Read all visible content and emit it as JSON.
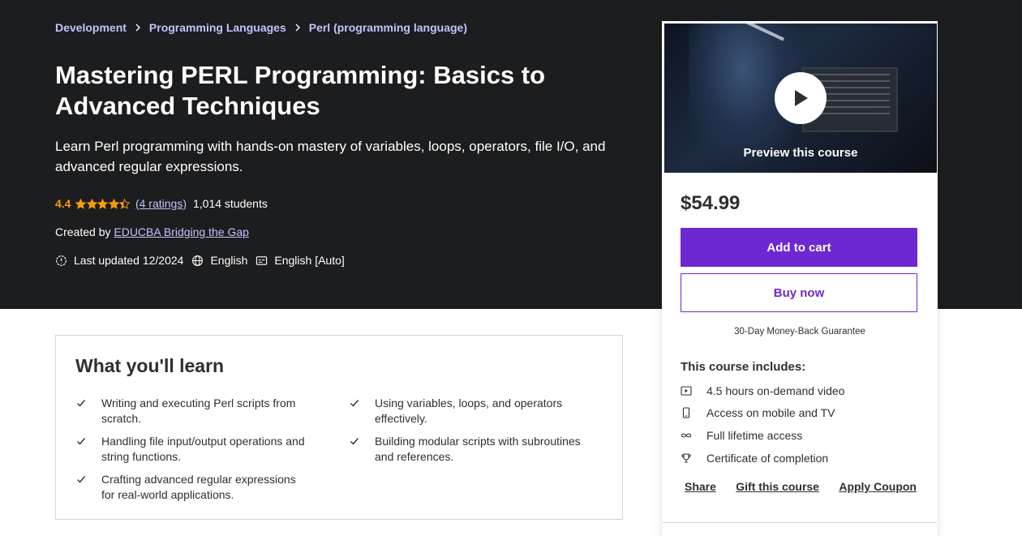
{
  "breadcrumb": {
    "items": [
      "Development",
      "Programming Languages",
      "Perl (programming language)"
    ]
  },
  "course": {
    "title": "Mastering PERL Programming: Basics to Advanced Techniques",
    "subtitle": "Learn Perl programming with hands-on mastery of variables, loops, operators, file I/O, and advanced regular expressions.",
    "rating": "4.4",
    "rating_value": 4.4,
    "ratings_link": "(4 ratings)",
    "students": "1,014 students",
    "created_by_label": "Created by",
    "instructor": "EDUCBA Bridging the Gap",
    "last_updated": "Last updated 12/2024",
    "language": "English",
    "captions": "English [Auto]"
  },
  "learn": {
    "title": "What you'll learn",
    "items": [
      "Writing and executing Perl scripts from scratch.",
      "Using variables, loops, and operators effectively.",
      "Handling file input/output operations and string functions.",
      "Building modular scripts with subroutines and references.",
      "Crafting advanced regular expressions for real-world applications."
    ]
  },
  "sidebar": {
    "preview_label": "Preview this course",
    "price": "$54.99",
    "add_to_cart": "Add to cart",
    "buy_now": "Buy now",
    "guarantee": "30-Day Money-Back Guarantee",
    "includes_title": "This course includes:",
    "includes": [
      {
        "icon": "video-icon",
        "label": "4.5 hours on-demand video"
      },
      {
        "icon": "mobile-icon",
        "label": "Access on mobile and TV"
      },
      {
        "icon": "infinity-icon",
        "label": "Full lifetime access"
      },
      {
        "icon": "trophy-icon",
        "label": "Certificate of completion"
      }
    ],
    "links": {
      "share": "Share",
      "gift": "Gift this course",
      "coupon": "Apply Coupon"
    }
  },
  "colors": {
    "hero_bg": "#1c1d1f",
    "link_purple": "#c0c4fc",
    "rating_orange": "#f69c08",
    "brand_purple": "#6d28d2"
  }
}
